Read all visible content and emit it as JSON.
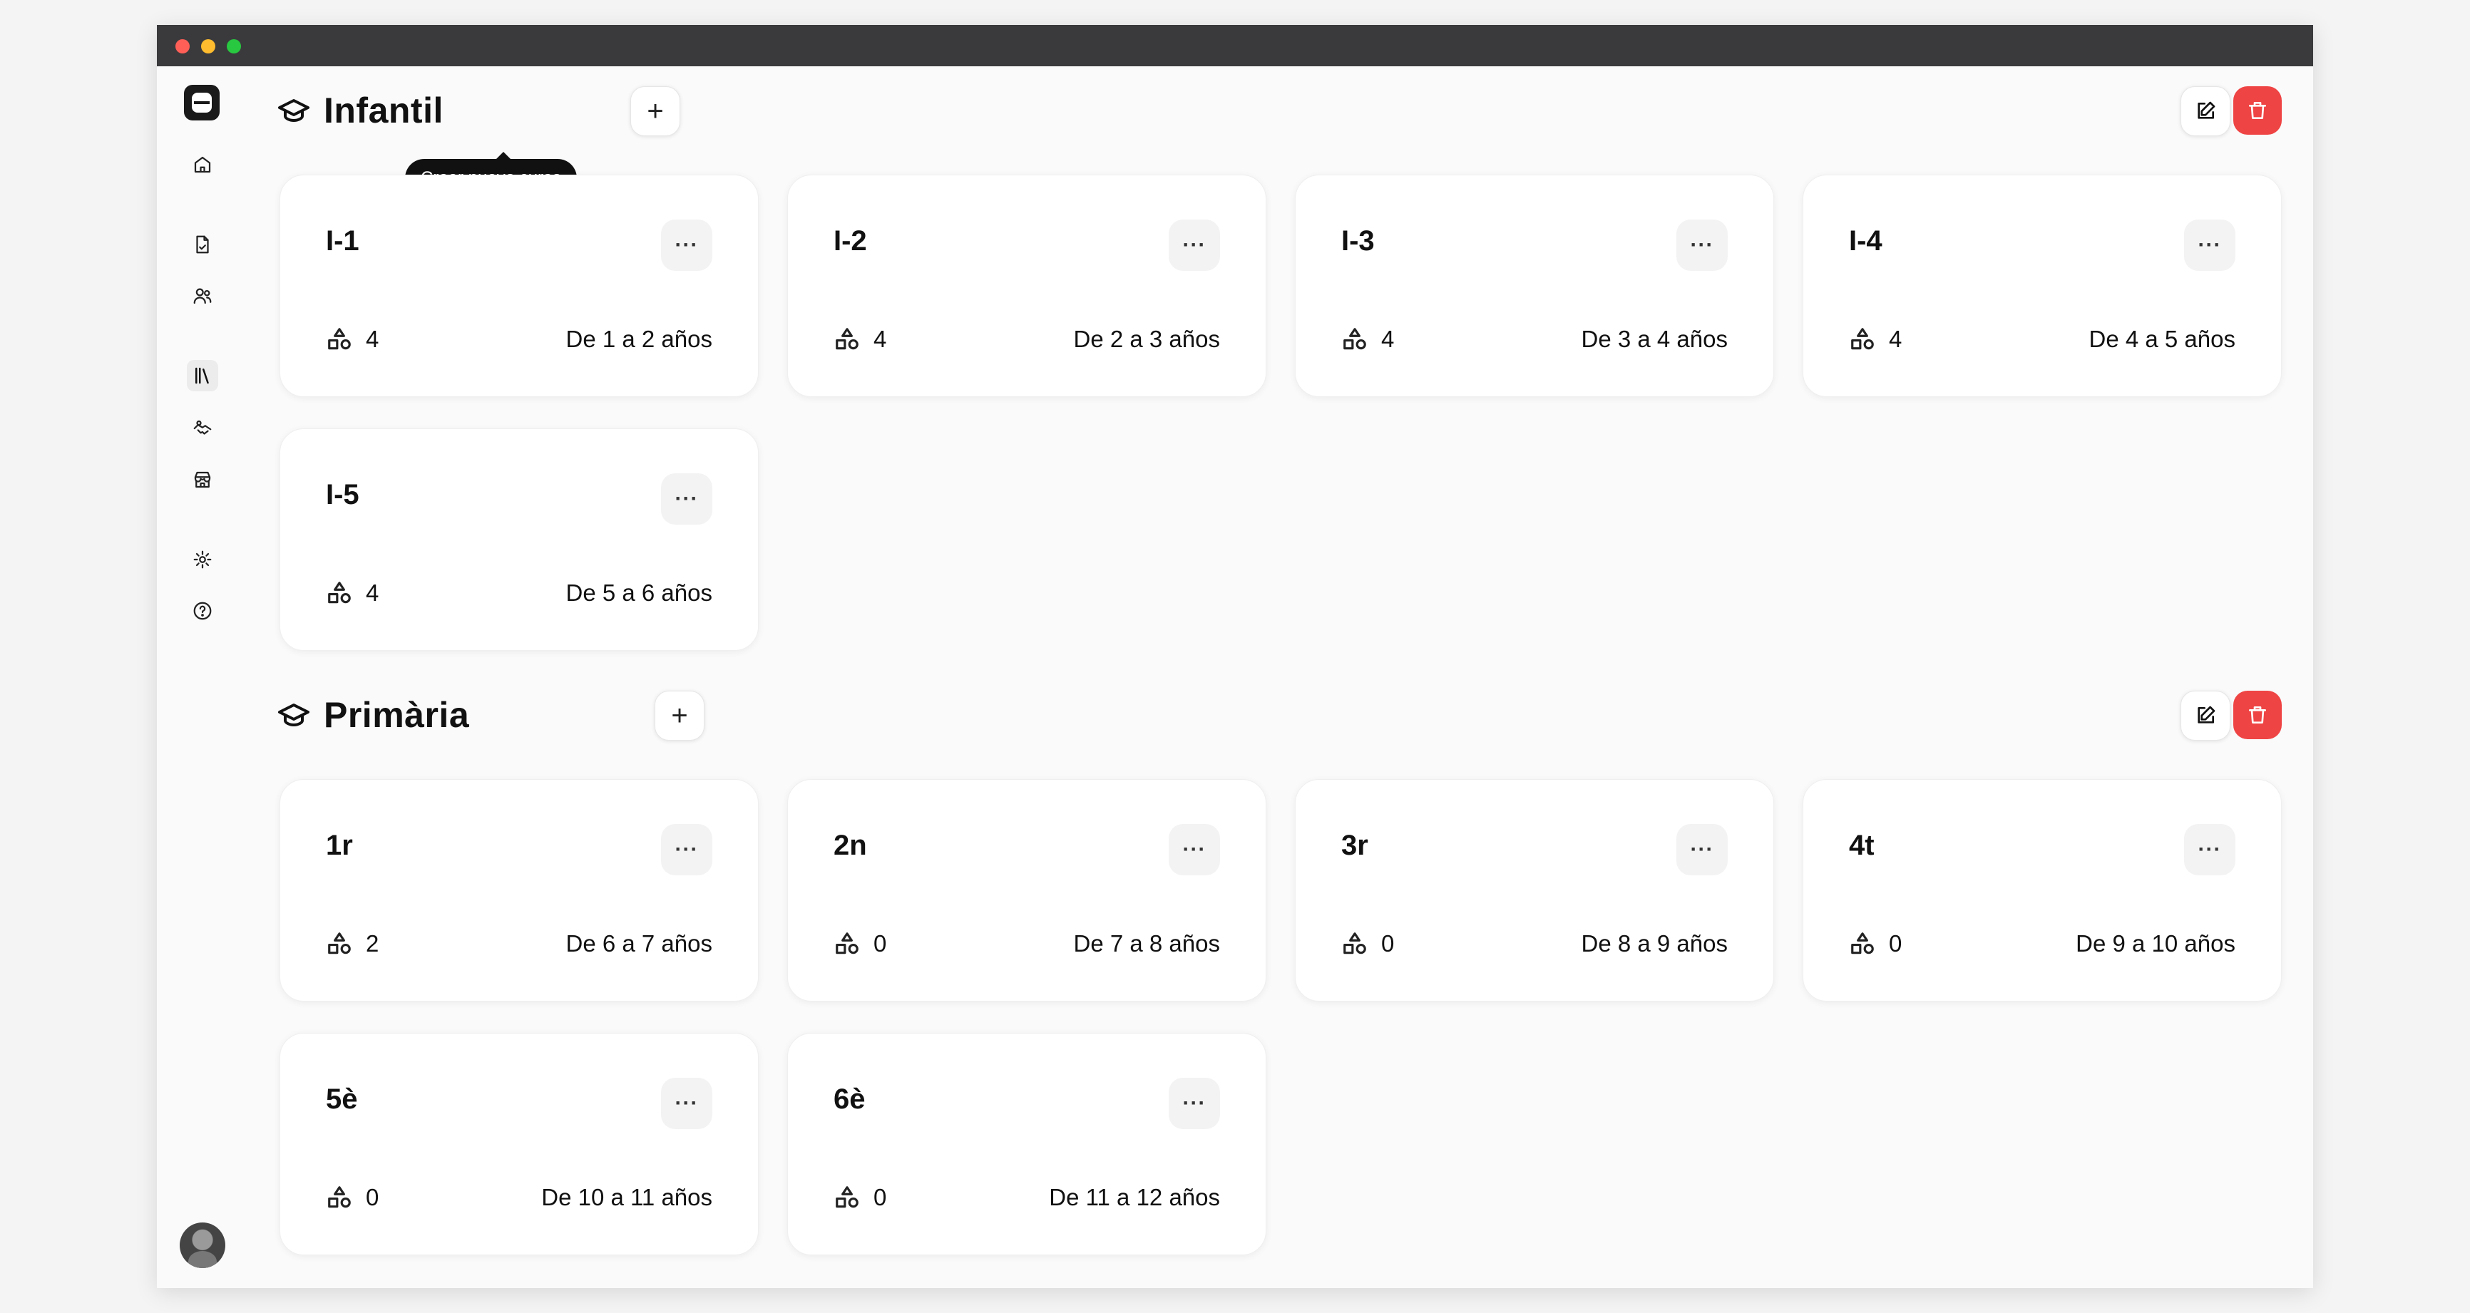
{
  "sidebar": {
    "items": [
      {
        "name": "home-icon"
      },
      {
        "name": "document-icon"
      },
      {
        "name": "users-icon"
      },
      {
        "name": "library-icon",
        "active": true
      },
      {
        "name": "handshake-icon"
      },
      {
        "name": "store-icon"
      },
      {
        "name": "settings-icon"
      },
      {
        "name": "help-icon"
      }
    ]
  },
  "tooltip": "Crear nuevo curso",
  "sections": [
    {
      "title": "Infantil",
      "courses": [
        {
          "name": "I-1",
          "count": "4",
          "age": "De 1 a 2 años"
        },
        {
          "name": "I-2",
          "count": "4",
          "age": "De 2 a 3 años"
        },
        {
          "name": "I-3",
          "count": "4",
          "age": "De 3 a 4 años"
        },
        {
          "name": "I-4",
          "count": "4",
          "age": "De 4 a 5 años"
        },
        {
          "name": "I-5",
          "count": "4",
          "age": "De 5 a 6 años"
        }
      ]
    },
    {
      "title": "Primària",
      "courses": [
        {
          "name": "1r",
          "count": "2",
          "age": "De 6 a 7 años"
        },
        {
          "name": "2n",
          "count": "0",
          "age": "De 7 a 8 años"
        },
        {
          "name": "3r",
          "count": "0",
          "age": "De 8 a 9 años"
        },
        {
          "name": "4t",
          "count": "0",
          "age": "De 9 a 10 años"
        },
        {
          "name": "5è",
          "count": "0",
          "age": "De 10 a 11 años"
        },
        {
          "name": "6è",
          "count": "0",
          "age": "De 11 a 12 años"
        }
      ]
    }
  ],
  "labels": {
    "add": "+",
    "more": "···"
  },
  "colors": {
    "accent_danger": "#ef4444",
    "titlebar": "#3a3a3c"
  }
}
